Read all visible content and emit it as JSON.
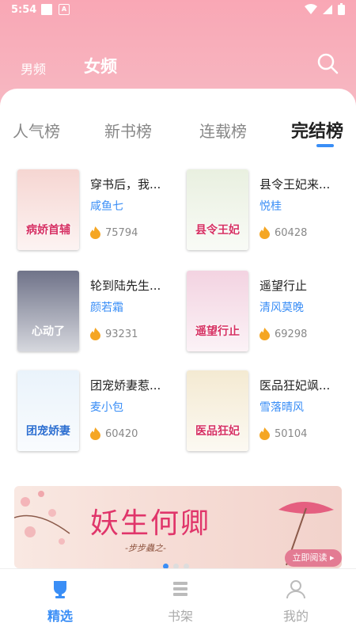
{
  "status": {
    "time": "5:54"
  },
  "header": {
    "male_tab": "男频",
    "female_tab": "女频"
  },
  "rank_tabs": [
    "人气榜",
    "新书榜",
    "连载榜",
    "完结榜"
  ],
  "books": [
    {
      "title": "穿书后，我...",
      "author": "咸鱼七",
      "heat": "75794",
      "cover_text": "病娇首辅",
      "cover_color": "#f6d6d2"
    },
    {
      "title": "县令王妃来...",
      "author": "悦桂",
      "heat": "60428",
      "cover_text": "县令王妃",
      "cover_color": "#e9f0e0"
    },
    {
      "title": "轮到陆先生...",
      "author": "颜若霜",
      "heat": "93231",
      "cover_text": "心动了",
      "cover_color": "#6f7389"
    },
    {
      "title": "遥望行止",
      "author": "清风莫晚",
      "heat": "69298",
      "cover_text": "遥望行止",
      "cover_color": "#f3d3e1"
    },
    {
      "title": "团宠娇妻惹...",
      "author": "麦小包",
      "heat": "60420",
      "cover_text": "团宠娇妻",
      "cover_color": "#eaf3fb"
    },
    {
      "title": "医品狂妃飒...",
      "author": "雪落晴风",
      "heat": "50104",
      "cover_text": "医品狂妃",
      "cover_color": "#f4ead2"
    }
  ],
  "banner": {
    "title": "妖生何卿",
    "author": "-步步蟲之-",
    "button": "立即阅读 ▸"
  },
  "bottom_nav": [
    {
      "label": "精选",
      "icon": "trophy-icon"
    },
    {
      "label": "书架",
      "icon": "bookshelf-icon"
    },
    {
      "label": "我的",
      "icon": "user-icon"
    }
  ],
  "colors": {
    "accent": "#3a8ef6",
    "header_pink": "#f9a7b5",
    "author_blue": "#3a8ef6",
    "flame": "#f5a623"
  }
}
